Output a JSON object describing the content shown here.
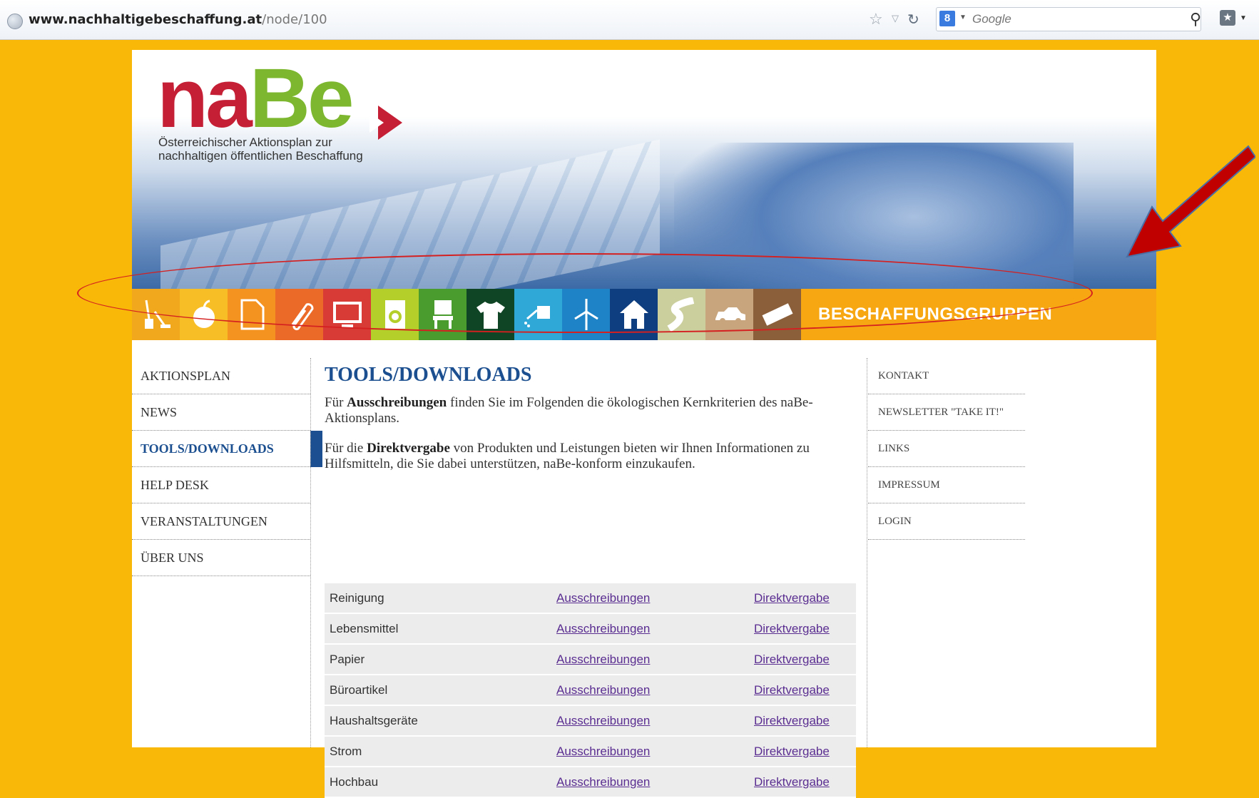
{
  "browser": {
    "url_domain": "www.nachhaltigebeschaffung.at",
    "url_path": "/node/100",
    "search_engine_label": "8",
    "search_placeholder": "Google",
    "search_icon": "magnifier-icon",
    "bookmark_icon": "bookmark-icon"
  },
  "logo": {
    "na": "na",
    "be": "Be",
    "subtitle_line1": "Österreichischer Aktionsplan zur",
    "subtitle_line2": "nachhaltigen öffentlichen Beschaffung"
  },
  "categories": {
    "tiles": [
      {
        "icon": "cleaning-icon",
        "color": "#f2a81d"
      },
      {
        "icon": "apple-icon",
        "color": "#f7be26"
      },
      {
        "icon": "paper-icon",
        "color": "#f4931f"
      },
      {
        "icon": "paperclip-icon",
        "color": "#ec6a28"
      },
      {
        "icon": "monitor-icon",
        "color": "#d83a36"
      },
      {
        "icon": "washing-machine-icon",
        "color": "#b5cf2a"
      },
      {
        "icon": "chair-icon",
        "color": "#4b9c2e"
      },
      {
        "icon": "tshirt-icon",
        "color": "#0f4524"
      },
      {
        "icon": "watering-can-icon",
        "color": "#2fa8d8"
      },
      {
        "icon": "wind-turbine-icon",
        "color": "#1f84c7"
      },
      {
        "icon": "house-icon",
        "color": "#0e3e7f"
      },
      {
        "icon": "road-icon",
        "color": "#cbcf9e"
      },
      {
        "icon": "car-icon",
        "color": "#c8a57d"
      },
      {
        "icon": "event-icon",
        "color": "#8b5f3a"
      }
    ],
    "label": "BESCHAFFUNGSGRUPPEN"
  },
  "left_nav": [
    {
      "label": "AKTIONSPLAN",
      "active": false
    },
    {
      "label": "NEWS",
      "active": false
    },
    {
      "label": "TOOLS/DOWNLOADS",
      "active": true
    },
    {
      "label": "HELP DESK",
      "active": false
    },
    {
      "label": "VERANSTALTUNGEN",
      "active": false
    },
    {
      "label": "ÜBER UNS",
      "active": false
    }
  ],
  "right_nav": [
    {
      "label": "KONTAKT"
    },
    {
      "label": "NEWSLETTER \"TAKE IT!\""
    },
    {
      "label": "LINKS"
    },
    {
      "label": "IMPRESSUM"
    },
    {
      "label": "LOGIN"
    }
  ],
  "main": {
    "title": "TOOLS/DOWNLOADS",
    "p1_pre": "Für ",
    "p1_bold": "Ausschreibungen",
    "p1_post": " finden Sie im Folgenden die ökologischen Kernkriterien des naBe-Aktionsplans.",
    "p2_pre": "Für die ",
    "p2_bold": "Direktvergabe",
    "p2_post": " von Produkten und Leistungen bieten wir Ihnen Informationen zu Hilfsmitteln, die Sie dabei unterstützen, naBe-konform einzukaufen."
  },
  "table": {
    "rows": [
      {
        "name": "Reinigung",
        "link1": "Ausschreibungen",
        "link2": "Direktvergabe"
      },
      {
        "name": "Lebensmittel",
        "link1": "Ausschreibungen",
        "link2": "Direktvergabe"
      },
      {
        "name": "Papier",
        "link1": "Ausschreibungen",
        "link2": "Direktvergabe"
      },
      {
        "name": "Büroartikel",
        "link1": "Ausschreibungen",
        "link2": "Direktvergabe"
      },
      {
        "name": "Haushaltsgeräte",
        "link1": "Ausschreibungen",
        "link2": "Direktvergabe"
      },
      {
        "name": "Strom",
        "link1": "Ausschreibungen",
        "link2": "Direktvergabe"
      },
      {
        "name": "Hochbau",
        "link1": "Ausschreibungen",
        "link2": "Direktvergabe"
      }
    ]
  },
  "colors": {
    "background": "#f9b808",
    "brand_red": "#c41f35",
    "brand_green": "#7cb72f",
    "nav_blue": "#1b4f8f",
    "annotation_red": "#d42020"
  }
}
